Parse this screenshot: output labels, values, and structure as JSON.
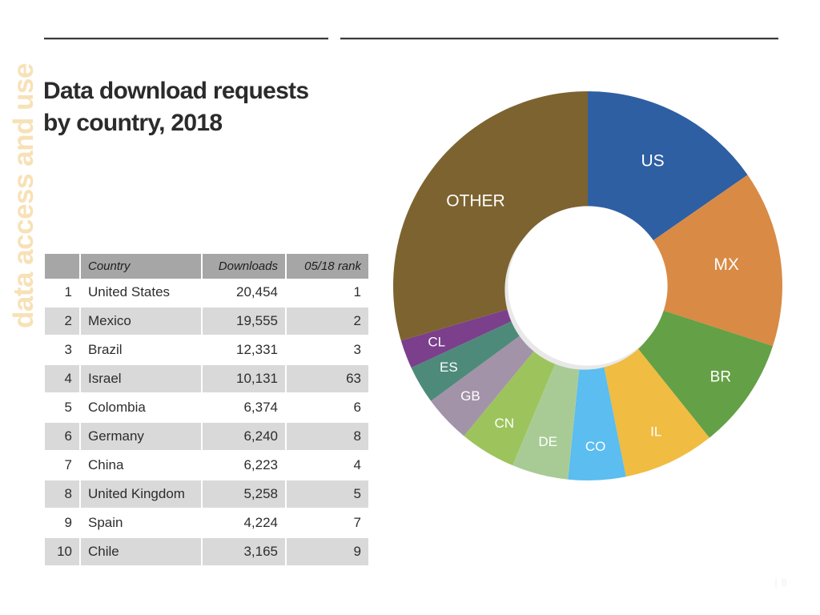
{
  "section_tab": {
    "label": "data access and use",
    "color": "#f7e1b6"
  },
  "slide": {
    "title_line1": "Data download requests",
    "title_line2": "by country, 2018",
    "page_number": "8",
    "page_separator": "|"
  },
  "table": {
    "headers": {
      "rank": "",
      "country": "Country",
      "downloads": "Downloads",
      "prior_rank": "05/18 rank"
    },
    "rows": [
      {
        "rank": "1",
        "country": "United States",
        "downloads": "20,454",
        "prior_rank": "1"
      },
      {
        "rank": "2",
        "country": "Mexico",
        "downloads": "19,555",
        "prior_rank": "2"
      },
      {
        "rank": "3",
        "country": "Brazil",
        "downloads": "12,331",
        "prior_rank": "3"
      },
      {
        "rank": "4",
        "country": "Israel",
        "downloads": "10,131",
        "prior_rank": "63"
      },
      {
        "rank": "5",
        "country": "Colombia",
        "downloads": "6,374",
        "prior_rank": "6"
      },
      {
        "rank": "6",
        "country": "Germany",
        "downloads": "6,240",
        "prior_rank": "8"
      },
      {
        "rank": "7",
        "country": "China",
        "downloads": "6,223",
        "prior_rank": "4"
      },
      {
        "rank": "8",
        "country": "United Kingdom",
        "downloads": "5,258",
        "prior_rank": "5"
      },
      {
        "rank": "9",
        "country": "Spain",
        "downloads": "4,224",
        "prior_rank": "7"
      },
      {
        "rank": "10",
        "country": "Chile",
        "downloads": "3,165",
        "prior_rank": "9"
      }
    ],
    "header_bg": "#a6a6a6",
    "stripe_bg": "#d9d9d9"
  },
  "chart_data": {
    "type": "pie",
    "variant": "donut",
    "title": "Data download requests by country, 2018",
    "xlabel": "",
    "ylabel": "",
    "start_angle_deg": 0,
    "direction": "clockwise",
    "inner_radius_ratio": 0.41,
    "legend": "none",
    "labels_inside": true,
    "categories": [
      "US",
      "MX",
      "BR",
      "IL",
      "CO",
      "DE",
      "CN",
      "GB",
      "ES",
      "CL",
      "OTHER"
    ],
    "names": [
      "United States",
      "Mexico",
      "Brazil",
      "Israel",
      "Colombia",
      "Germany",
      "China",
      "United Kingdom",
      "Spain",
      "Chile",
      "Other"
    ],
    "values": [
      20454,
      19555,
      12331,
      10131,
      6374,
      6240,
      6223,
      5258,
      4224,
      3165,
      39384
    ],
    "total": 133339,
    "percentages": [
      15.3,
      14.7,
      9.2,
      7.6,
      4.8,
      4.7,
      4.7,
      3.9,
      3.2,
      2.4,
      29.5
    ],
    "colors": [
      "#2e5fa3",
      "#d98a45",
      "#64a046",
      "#f0bc41",
      "#5bbdf0",
      "#a8cb96",
      "#9dc45c",
      "#a293a8",
      "#4e8a7a",
      "#7b3f8c",
      "#7d6330"
    ],
    "label_sizes": [
      "big",
      "big",
      "mid",
      "small",
      "small",
      "small",
      "small",
      "small",
      "small",
      "small",
      "big"
    ]
  }
}
